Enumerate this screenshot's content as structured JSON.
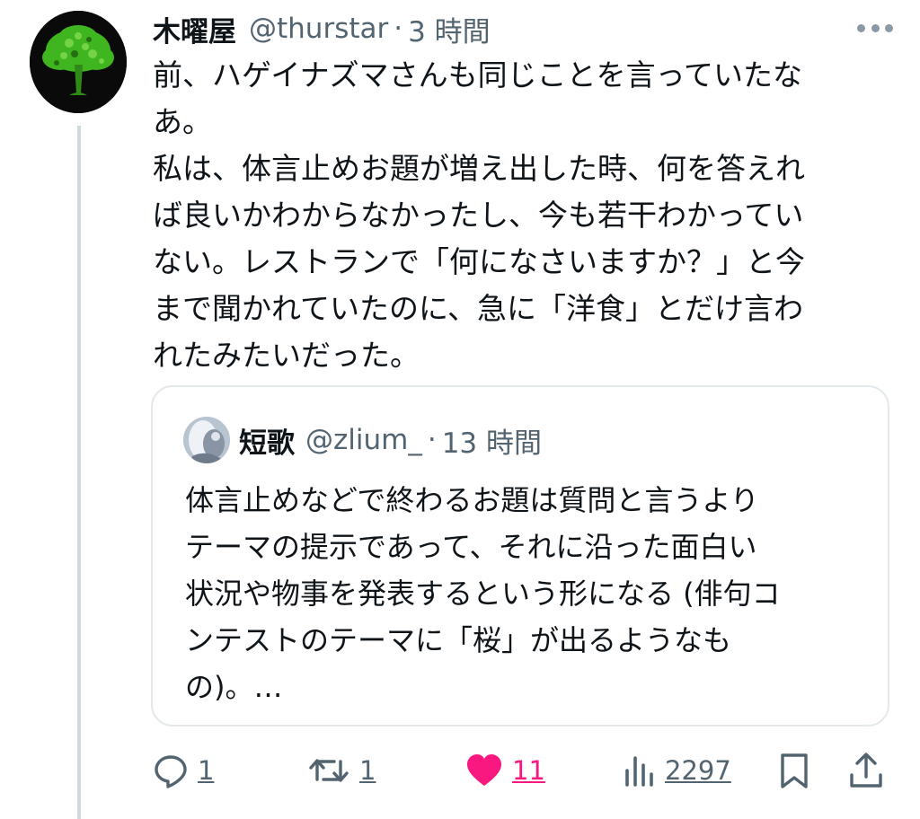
{
  "tweet": {
    "display_name": "木曜屋",
    "handle": "@thurstar",
    "separator": "·",
    "time": "3 時間",
    "text_lines": [
      "前、ハゲイナズマさんも同じことを言っていたな",
      "あ。",
      "私は、体言止めお題が増え出した時、何を答えれ",
      "ば良いかわからなかったし、今も若干わかってい",
      "ない。レストランで「何になさいますか？」と今",
      "まで聞かれていたのに、急に「洋食」とだけ言わ",
      "れたみたいだった。"
    ],
    "avatar_icon": "tree-avatar-icon",
    "more_icon": "more-dots-icon"
  },
  "quote": {
    "display_name": "短歌",
    "handle": "@zlium_",
    "separator": "·",
    "time": "13 時間",
    "text_lines": [
      "体言止めなどで終わるお題は質問と言うより",
      "テーマの提示であって、それに沿った面白い",
      "状況や物事を発表するという形になる (俳句コ",
      "ンテストのテーマに「桜」が出るようなも",
      "の)。…"
    ]
  },
  "actions": {
    "reply_count": "1",
    "retweet_count": "1",
    "like_count": "11",
    "views_count": "2297"
  },
  "colors": {
    "text": "#0f1419",
    "secondary": "#536471",
    "like": "#f91880",
    "border": "#e4e9ec",
    "thread_line": "#cfd9de"
  }
}
